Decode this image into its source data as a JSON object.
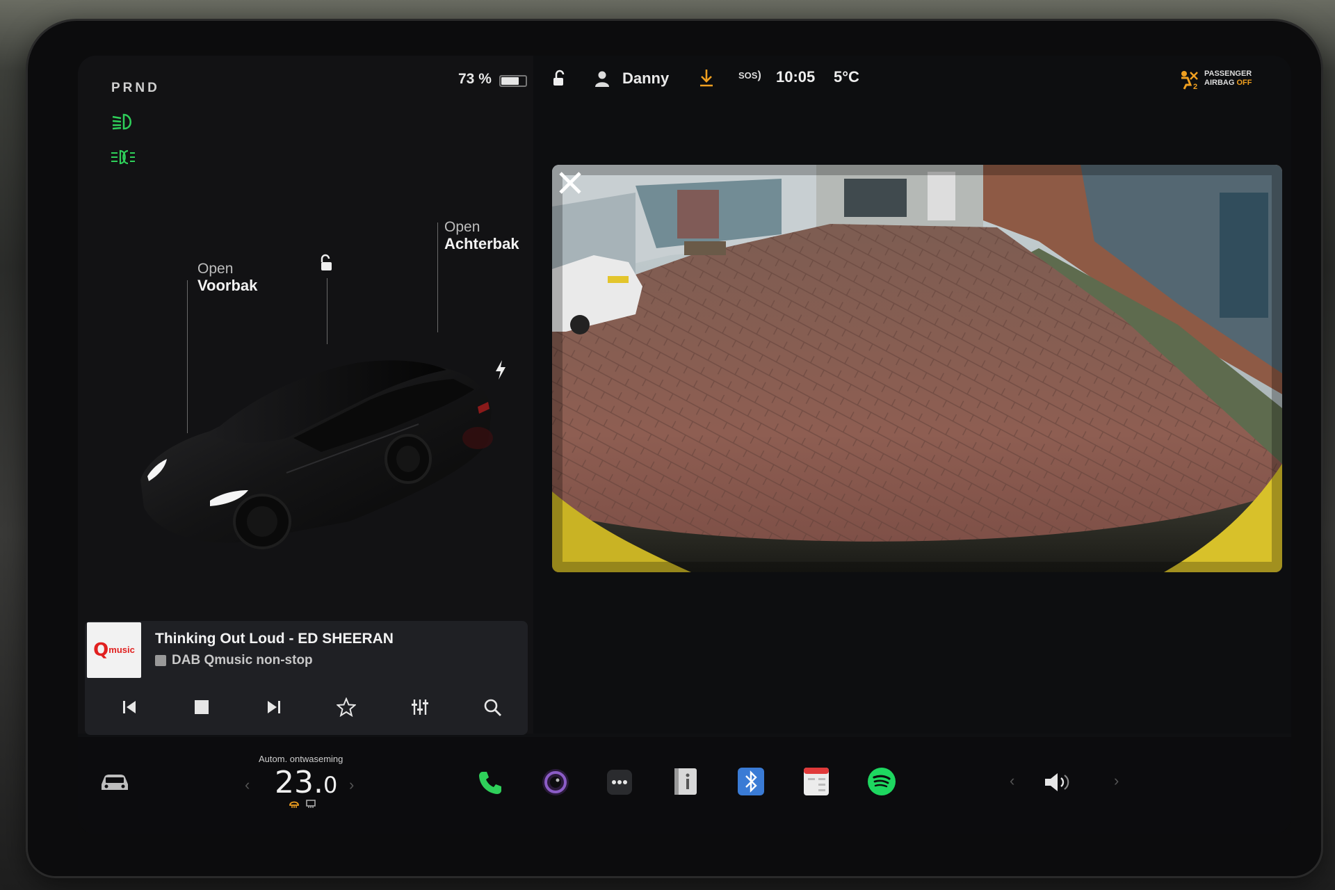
{
  "status_bar": {
    "gear": "PRND",
    "battery": "73 %",
    "battery_level": 0.73,
    "user": "Danny",
    "sos": "SOS",
    "time": "10:05",
    "temperature": "5°C",
    "airbag_line1": "PASSENGER",
    "airbag_line2": "AIRBAG",
    "airbag_state": "OFF"
  },
  "car": {
    "frunk_action": "Open",
    "frunk_label": "Voorbak",
    "trunk_action": "Open",
    "trunk_label": "Achterbak",
    "color": "#111111"
  },
  "media": {
    "title": "Thinking Out Loud - ED SHEERAN",
    "source": "DAB Qmusic non-stop",
    "logo_text": "music"
  },
  "climate": {
    "label": "Autom. ontwaseming",
    "temp_whole": "23.",
    "temp_decimal": "0"
  },
  "dock": {
    "icons": [
      "car-icon",
      "phone-icon",
      "camera-app-icon",
      "more-icon",
      "manual-icon",
      "bluetooth-icon",
      "calendar-icon",
      "spotify-icon",
      "volume-icon"
    ]
  },
  "colors": {
    "headlight_green": "#2fd05a",
    "accent_orange": "#f0a020",
    "bluetooth_blue": "#3a7bd5",
    "spotify_green": "#1ed760"
  }
}
